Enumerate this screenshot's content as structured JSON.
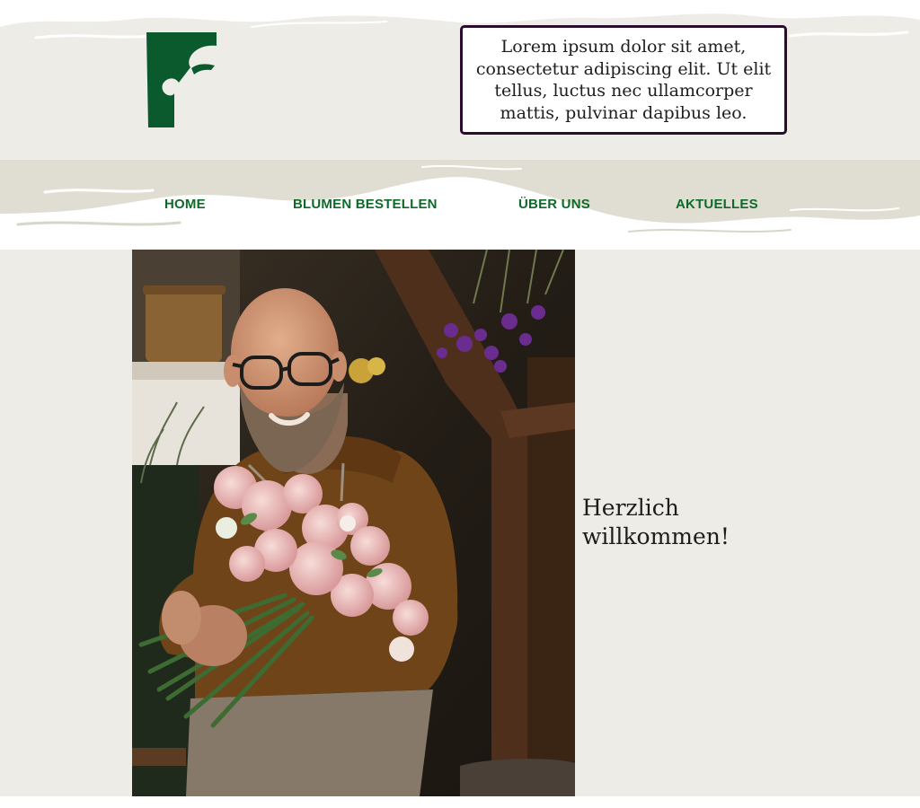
{
  "header": {
    "logo_letter": "F",
    "intro_text": "Lorem ipsum dolor sit amet, consectetur adipiscing elit. Ut elit tellus, luctus nec ullamcorper mattis, pulvinar dapibus leo."
  },
  "nav": {
    "items": [
      {
        "label": "HOME"
      },
      {
        "label": "BLUMEN BESTELLEN"
      },
      {
        "label": "ÜBER UNS"
      },
      {
        "label": "AKTUELLES"
      }
    ]
  },
  "main": {
    "welcome_text": "Herzlich willkommen!",
    "photo_alt": "Florist hält einen Strauß rosa Ranunkeln"
  },
  "colors": {
    "brand_green": "#0f6a2a",
    "box_border": "#2b0b2e",
    "background": "#edece6",
    "nav_band": "#e0ded3"
  }
}
